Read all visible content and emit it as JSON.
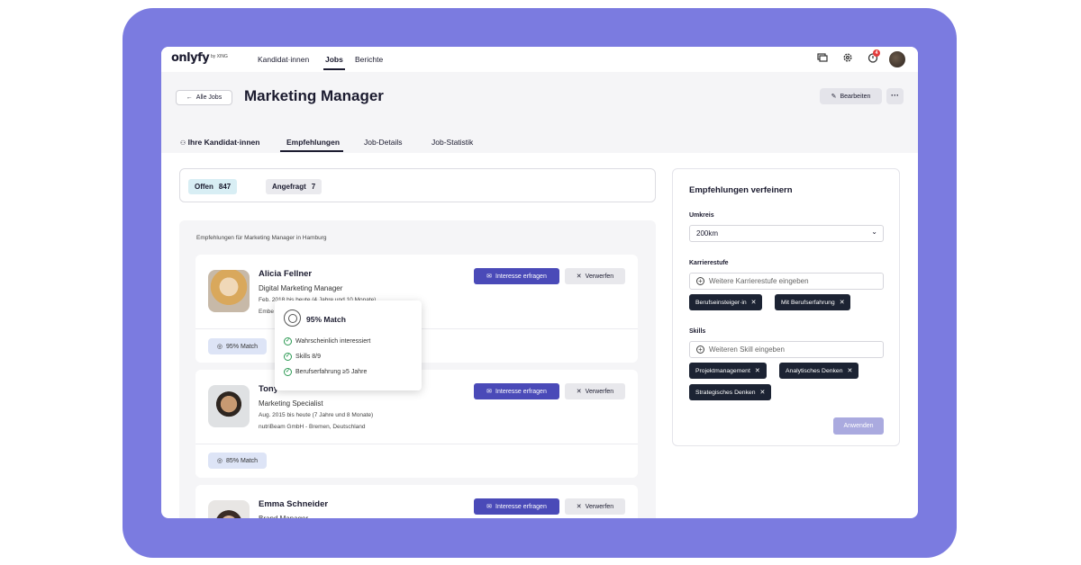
{
  "brand": {
    "logo": "onlyfy",
    "logo_sub": "by XING",
    "frame_color": "#7b7be0",
    "accent": "#4a4ab8"
  },
  "nav": {
    "items": [
      "Kandidat·innen",
      "Jobs",
      "Berichte"
    ],
    "active": "Jobs",
    "notification_count": "4"
  },
  "header": {
    "back_label": "Alle Jobs",
    "title": "Marketing Manager",
    "edit_label": "Bearbeiten",
    "more_label": "···",
    "tabs": [
      "Ihre Kandidat·innen",
      "Empfehlungen",
      "Job-Details",
      "Job-Statistik"
    ],
    "active_tab": "Empfehlungen"
  },
  "status": {
    "open_label": "Offen",
    "open_count": "847",
    "requested_label": "Angefragt",
    "requested_count": "7"
  },
  "recommendations": {
    "caption": "Empfehlungen für Marketing Manager in Hamburg",
    "interest_label": "Interesse erfragen",
    "discard_label": "Verwerfen",
    "candidates": [
      {
        "name": "Alicia Fellner",
        "role": "Digital Marketing Manager",
        "period": "Feb. 2018 bis heute (4 Jahre und 10 Monate)",
        "company": "Embe",
        "match": "95% Match"
      },
      {
        "name": "Tony",
        "role": "Marketing Specialist",
        "period": "Aug. 2015 bis heute (7 Jahre und 8 Monate)",
        "company": "nutriBeam GmbH - Bremen, Deutschland",
        "match": "85% Match"
      },
      {
        "name": "Emma Schneider",
        "role": "Brand Manager"
      }
    ]
  },
  "tooltip": {
    "title": "95% Match",
    "items": [
      "Wahrscheinlich interessiert",
      "Skills 8/9",
      "Berufserfahrung ≥5 Jahre"
    ]
  },
  "refine": {
    "title": "Empfehlungen verfeinern",
    "radius_label": "Umkreis",
    "radius_value": "200km",
    "career_label": "Karrierestufe",
    "career_placeholder": "Weitere Karrierestufe eingeben",
    "career_tags": [
      "Berufseinsteiger·in",
      "Mit Berufserfahrung"
    ],
    "skills_label": "Skills",
    "skills_placeholder": "Weiteren Skill eingeben",
    "skill_tags": [
      "Projektmanagement",
      "Analytisches Denken",
      "Strategisches Denken"
    ],
    "apply_label": "Anwenden"
  },
  "icons": [
    "chat-icon",
    "gear-icon",
    "bell-icon",
    "user-avatar",
    "arrow-left-icon",
    "pencil-icon",
    "mail-icon",
    "close-icon",
    "target-icon",
    "check-circle-icon",
    "chevron-down-icon",
    "plus-circle-icon",
    "users-icon"
  ]
}
